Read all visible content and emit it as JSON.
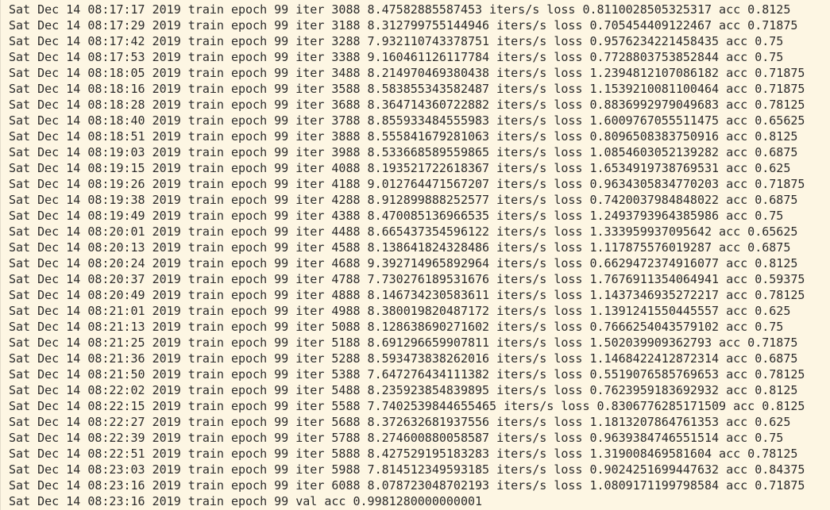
{
  "log": {
    "lines": [
      "Sat Dec 14 08:17:17 2019 train epoch 99 iter 3088 8.47582885587453 iters/s loss 0.8110028505325317 acc 0.8125",
      "Sat Dec 14 08:17:29 2019 train epoch 99 iter 3188 8.312799755144946 iters/s loss 0.705454409122467 acc 0.71875",
      "Sat Dec 14 08:17:42 2019 train epoch 99 iter 3288 7.932110743378751 iters/s loss 0.9576234221458435 acc 0.75",
      "Sat Dec 14 08:17:53 2019 train epoch 99 iter 3388 9.160461126117784 iters/s loss 0.7728803753852844 acc 0.75",
      "Sat Dec 14 08:18:05 2019 train epoch 99 iter 3488 8.214970469380438 iters/s loss 1.2394812107086182 acc 0.71875",
      "Sat Dec 14 08:18:16 2019 train epoch 99 iter 3588 8.583855343582487 iters/s loss 1.1539210081100464 acc 0.71875",
      "Sat Dec 14 08:18:28 2019 train epoch 99 iter 3688 8.364714360722882 iters/s loss 0.8836992979049683 acc 0.78125",
      "Sat Dec 14 08:18:40 2019 train epoch 99 iter 3788 8.855933484555983 iters/s loss 1.6009767055511475 acc 0.65625",
      "Sat Dec 14 08:18:51 2019 train epoch 99 iter 3888 8.555841679281063 iters/s loss 0.8096508383750916 acc 0.8125",
      "Sat Dec 14 08:19:03 2019 train epoch 99 iter 3988 8.533668589559865 iters/s loss 1.0854603052139282 acc 0.6875",
      "Sat Dec 14 08:19:15 2019 train epoch 99 iter 4088 8.193521722618367 iters/s loss 1.6534919738769531 acc 0.625",
      "Sat Dec 14 08:19:26 2019 train epoch 99 iter 4188 9.012764471567207 iters/s loss 0.9634305834770203 acc 0.71875",
      "Sat Dec 14 08:19:38 2019 train epoch 99 iter 4288 8.912899888252577 iters/s loss 0.7420037984848022 acc 0.6875",
      "Sat Dec 14 08:19:49 2019 train epoch 99 iter 4388 8.470085136966535 iters/s loss 1.2493793964385986 acc 0.75",
      "Sat Dec 14 08:20:01 2019 train epoch 99 iter 4488 8.665437354596122 iters/s loss 1.333959937095642 acc 0.65625",
      "Sat Dec 14 08:20:13 2019 train epoch 99 iter 4588 8.138641824328486 iters/s loss 1.117875576019287 acc 0.6875",
      "Sat Dec 14 08:20:24 2019 train epoch 99 iter 4688 9.392714965892964 iters/s loss 0.6629472374916077 acc 0.8125",
      "Sat Dec 14 08:20:37 2019 train epoch 99 iter 4788 7.730276189531676 iters/s loss 1.7676911354064941 acc 0.59375",
      "Sat Dec 14 08:20:49 2019 train epoch 99 iter 4888 8.146734230583611 iters/s loss 1.1437346935272217 acc 0.78125",
      "Sat Dec 14 08:21:01 2019 train epoch 99 iter 4988 8.380019820487172 iters/s loss 1.1391241550445557 acc 0.625",
      "Sat Dec 14 08:21:13 2019 train epoch 99 iter 5088 8.128638690271602 iters/s loss 0.7666254043579102 acc 0.75",
      "Sat Dec 14 08:21:25 2019 train epoch 99 iter 5188 8.691296659907811 iters/s loss 1.502039909362793 acc 0.71875",
      "Sat Dec 14 08:21:36 2019 train epoch 99 iter 5288 8.593473838262016 iters/s loss 1.1468422412872314 acc 0.6875",
      "Sat Dec 14 08:21:50 2019 train epoch 99 iter 5388 7.647276434111382 iters/s loss 0.5519076585769653 acc 0.78125",
      "Sat Dec 14 08:22:02 2019 train epoch 99 iter 5488 8.235923854839895 iters/s loss 0.7623959183692932 acc 0.8125",
      "Sat Dec 14 08:22:15 2019 train epoch 99 iter 5588 7.7402539844655465 iters/s loss 0.8306776285171509 acc 0.8125",
      "Sat Dec 14 08:22:27 2019 train epoch 99 iter 5688 8.372632681937556 iters/s loss 1.1813207864761353 acc 0.625",
      "Sat Dec 14 08:22:39 2019 train epoch 99 iter 5788 8.274600880058587 iters/s loss 0.9639384746551514 acc 0.75",
      "Sat Dec 14 08:22:51 2019 train epoch 99 iter 5888 8.427529195183283 iters/s loss 1.319008469581604 acc 0.78125",
      "Sat Dec 14 08:23:03 2019 train epoch 99 iter 5988 7.814512349593185 iters/s loss 0.9024251699447632 acc 0.84375",
      "Sat Dec 14 08:23:16 2019 train epoch 99 iter 6088 8.078723048702193 iters/s loss 1.0809171199798584 acc 0.71875",
      "Sat Dec 14 08:23:16 2019 train epoch 99 val acc 0.9981280000000001"
    ]
  }
}
